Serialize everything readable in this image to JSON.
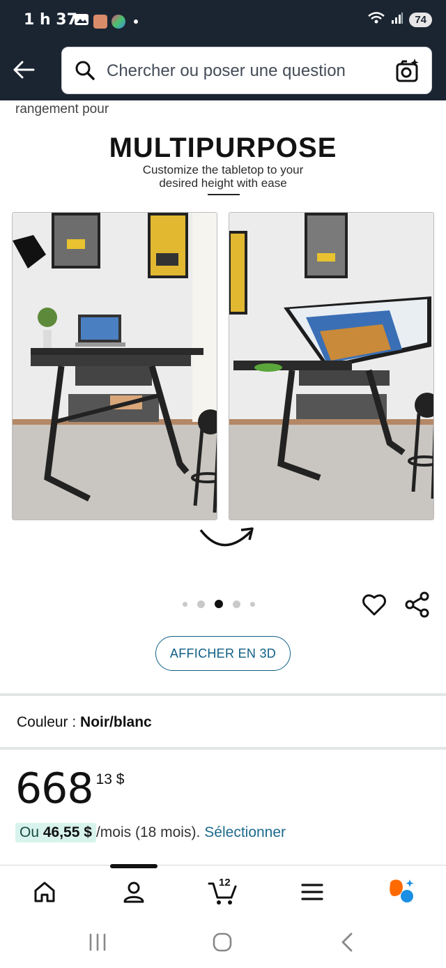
{
  "status_bar": {
    "time": "1 h 37",
    "battery": "74"
  },
  "header": {
    "search_placeholder": "Chercher ou poser une question"
  },
  "gallery": {
    "partial_title": "rangement pour",
    "image_headline": "MULTIPURPOSE",
    "image_subtitle_line1": "Customize the tabletop to your",
    "image_subtitle_line2": "desired height with ease",
    "dot_count": 5,
    "active_dot": 3
  },
  "view3d_label": "AFFICHER EN 3D",
  "color": {
    "label": "Couleur : ",
    "value": "Noir/blanc"
  },
  "price": {
    "whole": "668",
    "cents": "13 $"
  },
  "installment": {
    "prefix": "Ou ",
    "amount": "46,55 $",
    "suffix": " /mois (18 mois).",
    "link": "Sélectionner"
  },
  "bottom_nav": {
    "cart_count": "12"
  },
  "colors": {
    "header_bg": "#1b2532",
    "link": "#1d6a8c",
    "accent_orange": "#ff6a00",
    "accent_blue": "#1a8fe3"
  }
}
